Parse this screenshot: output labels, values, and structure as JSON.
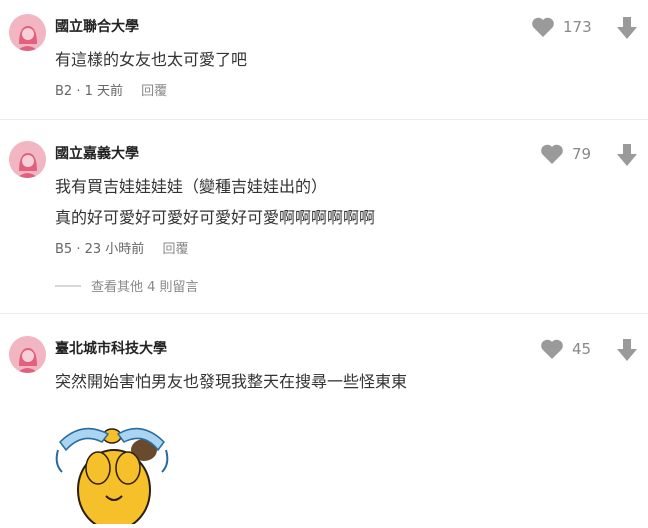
{
  "comments": [
    {
      "author": "國立聯合大學",
      "lines": [
        "有這樣的女友也太可愛了吧"
      ],
      "floor": "B2",
      "time": "1 天前",
      "reply_label": "回覆",
      "likes": "173",
      "more_replies": ""
    },
    {
      "author": "國立嘉義大學",
      "lines": [
        "我有買吉娃娃娃娃（變種吉娃娃出的）",
        "真的好可愛好可愛好可愛好可愛啊啊啊啊啊啊"
      ],
      "floor": "B5",
      "time": "23 小時前",
      "reply_label": "回覆",
      "likes": "79",
      "more_replies": "查看其他 4 則留言"
    },
    {
      "author": "臺北城市科技大學",
      "lines": [
        "突然開始害怕男友也發現我整天在搜尋一些怪東東"
      ],
      "likes": "45",
      "sticker": "crying-bear-sticker"
    }
  ],
  "meta_separator": "·",
  "icons": {
    "like": "heart-icon",
    "dislike": "arrow-down-icon",
    "avatar": "female-avatar-icon"
  },
  "colors": {
    "avatar_bg": "#f2b6c3",
    "avatar_fg": "#e0607e",
    "icon_gray": "#9a9a9a"
  }
}
